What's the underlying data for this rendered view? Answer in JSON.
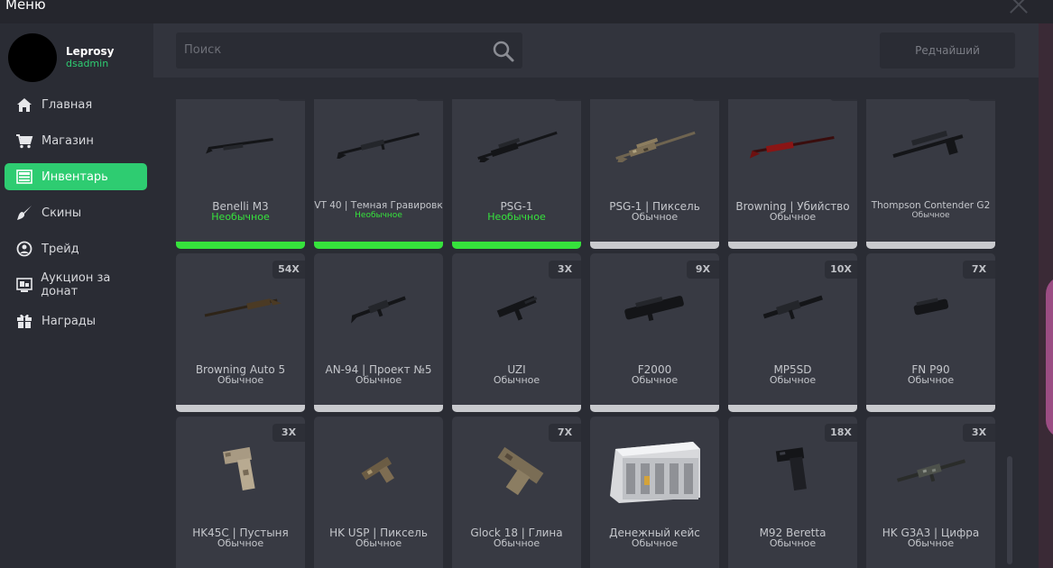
{
  "window": {
    "title": "Меню"
  },
  "user": {
    "name": "Leprosy",
    "role": "dsadmin"
  },
  "sidebar": {
    "items": [
      {
        "label": "Главная",
        "icon": "home-icon",
        "active": false
      },
      {
        "label": "Магазин",
        "icon": "cart-icon",
        "active": false
      },
      {
        "label": "Инвентарь",
        "icon": "inventory-icon",
        "active": true
      },
      {
        "label": "Скины",
        "icon": "brush-icon",
        "active": false
      },
      {
        "label": "Трейд",
        "icon": "trade-icon",
        "active": false
      },
      {
        "label": "Аукцион за донат",
        "icon": "auction-icon",
        "active": false
      },
      {
        "label": "Награды",
        "icon": "gift-icon",
        "active": false
      }
    ]
  },
  "search": {
    "placeholder": "Поиск"
  },
  "filter": {
    "label": "Редчайший"
  },
  "colors": {
    "accent": "#2ecc71",
    "uncommon": "#36e23c",
    "common": "#c9cace"
  },
  "inventory": {
    "items": [
      {
        "name": "Benelli M3",
        "rarity": "Необычное",
        "count": "",
        "type": "shotgun"
      },
      {
        "name": "VT 40 | Темная Гравировк",
        "rarity": "Необычное",
        "count": "",
        "type": "rifle"
      },
      {
        "name": "PSG-1",
        "rarity": "Необычное",
        "count": "",
        "type": "sniper"
      },
      {
        "name": "PSG-1 | Пиксель",
        "rarity": "Обычное",
        "count": "",
        "type": "sniper-camo"
      },
      {
        "name": "Browning | Убийство",
        "rarity": "Обычное",
        "count": "",
        "type": "rifle-red"
      },
      {
        "name": "Thompson Contender G2",
        "rarity": "Обычное",
        "count": "",
        "type": "pistol-scope"
      },
      {
        "name": "Browning Auto 5",
        "rarity": "Обычное",
        "count": "54X",
        "type": "shotgun-wood"
      },
      {
        "name": "AN-94 | Проект №5",
        "rarity": "Обычное",
        "count": "",
        "type": "assault"
      },
      {
        "name": "UZI",
        "rarity": "Обычное",
        "count": "3X",
        "type": "smg"
      },
      {
        "name": "F2000",
        "rarity": "Обычное",
        "count": "9X",
        "type": "bullpup"
      },
      {
        "name": "MP5SD",
        "rarity": "Обычное",
        "count": "10X",
        "type": "smg-long"
      },
      {
        "name": "FN P90",
        "rarity": "Обычное",
        "count": "7X",
        "type": "p90"
      },
      {
        "name": "HK45C | Пустыня",
        "rarity": "Обычное",
        "count": "3X",
        "type": "pistol-desert"
      },
      {
        "name": "HK USP | Пиксель",
        "rarity": "Обычное",
        "count": "",
        "type": "pistol-pixel"
      },
      {
        "name": "Glock 18 | Глина",
        "rarity": "Обычное",
        "count": "7X",
        "type": "glock"
      },
      {
        "name": "Денежный кейс",
        "rarity": "Обычное",
        "count": "",
        "type": "case"
      },
      {
        "name": "M92 Beretta",
        "rarity": "Обычное",
        "count": "18X",
        "type": "pistol-black"
      },
      {
        "name": "HK G3A3 | Цифра",
        "rarity": "Обычное",
        "count": "3X",
        "type": "rifle-digital"
      }
    ]
  }
}
